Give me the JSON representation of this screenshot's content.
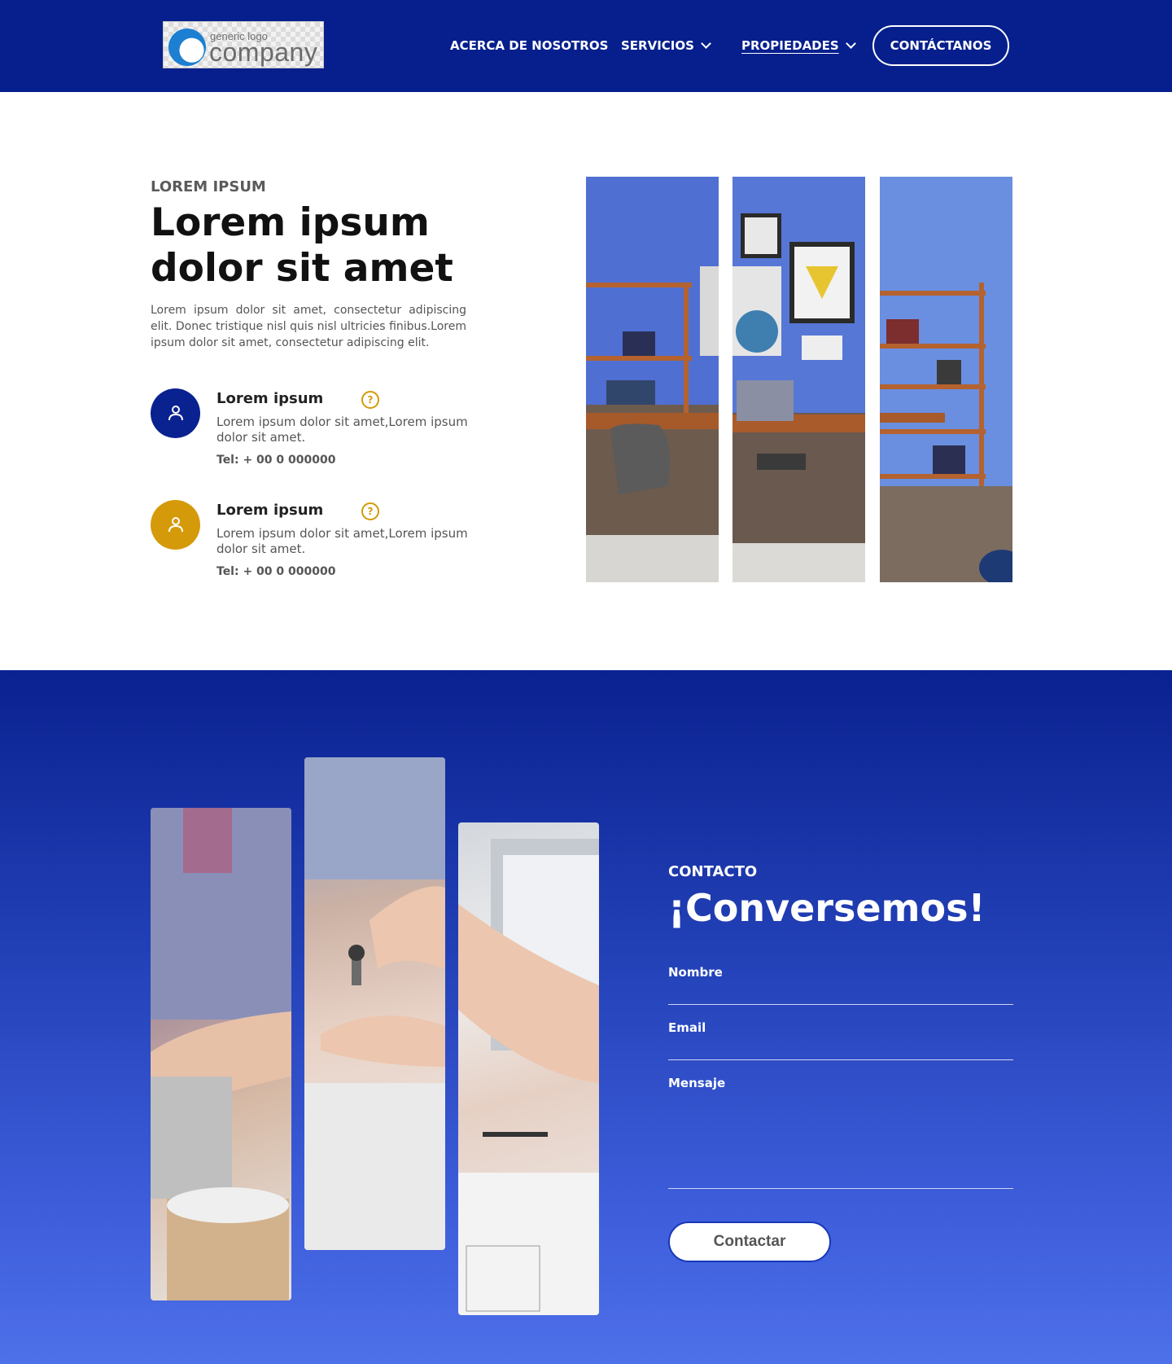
{
  "header": {
    "logo": {
      "top_text": "generic logo",
      "main_text": "company"
    },
    "nav": [
      {
        "label": "ACERCA DE NOSOTROS"
      },
      {
        "label": "SERVICIOS"
      },
      {
        "label": "PROPIEDADES"
      }
    ],
    "cta_label": "CONTÁCTANOS"
  },
  "intro": {
    "eyebrow": "LOREM IPSUM",
    "title": "Lorem ipsum dolor sit amet",
    "paragraph": "Lorem ipsum dolor sit amet, consectetur adipiscing elit. Donec tristique nisl quis nisl ultricies finibus.Lorem ipsum dolor sit amet, consectetur adipiscing elit.",
    "agents": [
      {
        "name": "Lorem ipsum",
        "text": "Lorem ipsum dolor sit amet,Lorem ipsum dolor sit amet.",
        "tel": "Tel: + 00 0 000000",
        "color": "#0a2190"
      },
      {
        "name": "Lorem ipsum",
        "text": "Lorem ipsum dolor sit amet,Lorem ipsum dolor sit amet.",
        "tel": "Tel: + 00 0 000000",
        "color": "#d59a09"
      }
    ]
  },
  "contact": {
    "eyebrow": "CONTACTO",
    "title": "¡Conversemos!",
    "fields": [
      {
        "label": "Nombre"
      },
      {
        "label": "Email"
      },
      {
        "label": "Mensaje"
      }
    ],
    "submit_label": "Contactar"
  },
  "colors": {
    "brand_blue": "#061f8c",
    "accent_gold": "#d59a09"
  }
}
